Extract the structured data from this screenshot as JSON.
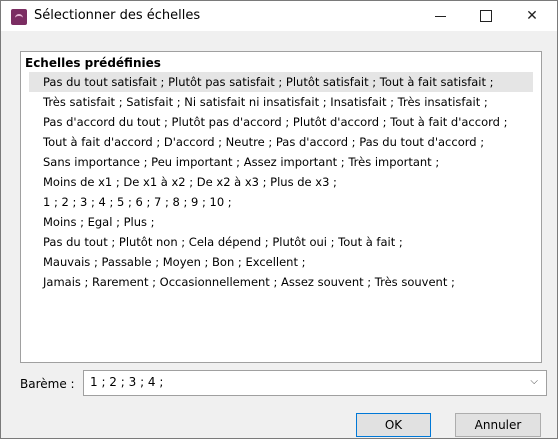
{
  "window": {
    "title": "Sélectionner des échelles",
    "icon": "app-icon"
  },
  "list": {
    "header": "Echelles prédéfinies",
    "items": [
      "Pas du tout satisfait ; Plutôt pas satisfait ; Plutôt satisfait ; Tout à fait satisfait ;",
      "Très satisfait ; Satisfait ; Ni satisfait ni insatisfait ; Insatisfait ; Très insatisfait ;",
      "Pas d'accord du tout ; Plutôt pas d'accord ; Plutôt d'accord ; Tout à fait d'accord ;",
      "Tout à fait d'accord ; D'accord ; Neutre ; Pas d'accord ; Pas du tout d'accord ;",
      "Sans importance ; Peu important ; Assez important ; Très important ;",
      "Moins de x1 ; De x1 à x2 ; De x2 à x3 ; Plus de x3 ;",
      "1 ; 2 ; 3 ; 4 ; 5 ; 6 ; 7 ; 8 ; 9 ; 10 ;",
      "Moins ; Egal ; Plus ;",
      "Pas du tout ; Plutôt non ; Cela dépend ; Plutôt oui ; Tout à fait ;",
      "Mauvais ; Passable ; Moyen ; Bon ; Excellent ;",
      "Jamais ; Rarement ; Occasionnellement ; Assez souvent ; Très souvent ;"
    ]
  },
  "bareme": {
    "label": "Barème :",
    "value": "1 ; 2 ; 3 ; 4 ;"
  },
  "buttons": {
    "ok": "OK",
    "cancel": "Annuler"
  }
}
